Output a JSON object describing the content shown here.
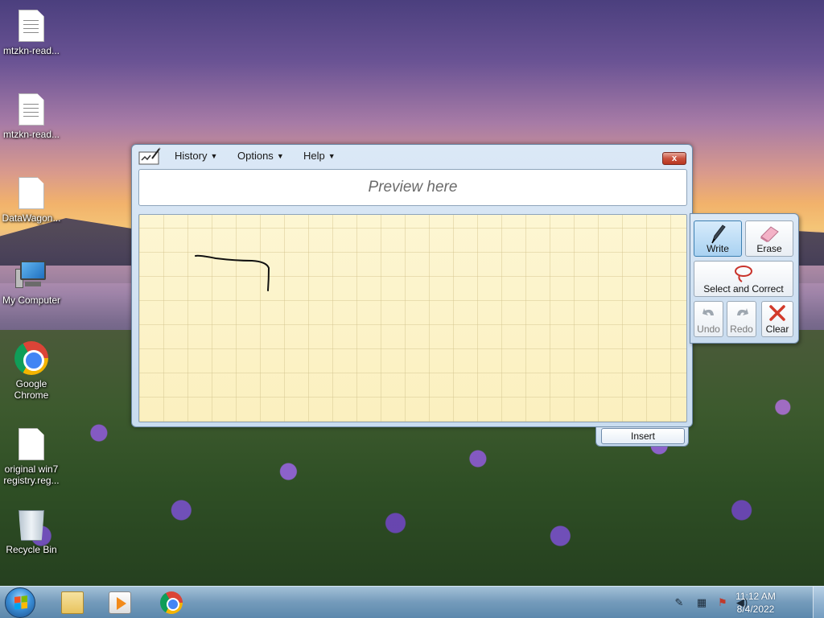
{
  "desktop": {
    "icons": [
      {
        "label": "mtzkn-read...",
        "icon": "text-document-icon"
      },
      {
        "label": "mtzkn-read...",
        "icon": "text-document-icon"
      },
      {
        "label": "DataWagon...",
        "icon": "blank-document-icon"
      },
      {
        "label": "My Computer",
        "icon": "computer-icon"
      },
      {
        "label": "Google Chrome",
        "icon": "chrome-icon"
      },
      {
        "label": "original win7 registry.reg...",
        "icon": "registry-file-icon"
      },
      {
        "label": "Recycle Bin",
        "icon": "recycle-bin-icon"
      }
    ]
  },
  "input_panel": {
    "menu": {
      "history": "History",
      "options": "Options",
      "help": "Help"
    },
    "close_label": "x",
    "preview_text": "Preview here",
    "insert_label": "Insert",
    "tools": {
      "write": "Write",
      "erase": "Erase",
      "select_correct": "Select and Correct",
      "undo": "Undo",
      "redo": "Redo",
      "clear": "Clear"
    },
    "active_tool": "Write"
  },
  "taskbar": {
    "apps": [
      "windows-explorer-icon",
      "media-player-icon",
      "chrome-icon"
    ],
    "tray_icons": [
      "pen-input-icon",
      "network-icon",
      "action-center-flag-icon",
      "volume-icon"
    ],
    "clock": {
      "time": "11:12 AM",
      "date": "8/4/2022"
    }
  },
  "colors": {
    "accent": "#3c7fb1",
    "writing_pad": "#fbf0bf",
    "close_button": "#c9523e"
  }
}
